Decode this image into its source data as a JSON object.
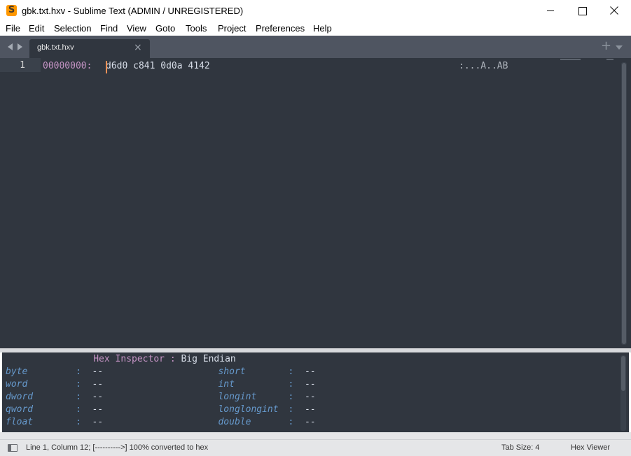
{
  "window": {
    "title": "gbk.txt.hxv - Sublime Text (ADMIN / UNREGISTERED)",
    "app_icon_letter": "S",
    "app_icon_color": "#ff9800"
  },
  "menu": [
    "File",
    "Edit",
    "Selection",
    "Find",
    "View",
    "Goto",
    "Tools",
    "Project",
    "Preferences",
    "Help"
  ],
  "tabs": [
    {
      "label": "gbk.txt.hxv",
      "active": true
    }
  ],
  "editor": {
    "line_number": "1",
    "offset": "00000000:",
    "bytes": "d6d0 c841 0d0a 4142",
    "ascii": ":...A..AB"
  },
  "inspector": {
    "title_kw": "Hex Inspector",
    "title_sep": ":",
    "endian": "Big Endian",
    "rows": [
      {
        "left_label": "byte",
        "left_value": "--",
        "right_label": "short",
        "right_value": "--"
      },
      {
        "left_label": "word",
        "left_value": "--",
        "right_label": "int",
        "right_value": "--"
      },
      {
        "left_label": "dword",
        "left_value": "--",
        "right_label": "longint",
        "right_value": "--"
      },
      {
        "left_label": "qword",
        "left_value": "--",
        "right_label": "longlongint",
        "right_value": "--"
      },
      {
        "left_label": "float",
        "left_value": "--",
        "right_label": "double",
        "right_value": "--"
      }
    ]
  },
  "status": {
    "position": "Line 1, Column 12; [---------->] 100% converted to hex",
    "tab_size": "Tab Size: 4",
    "syntax": "Hex Viewer"
  },
  "colors": {
    "editor_bg": "#30363f",
    "tabbar_bg": "#4f5561",
    "offset_color": "#c594c5",
    "type_color": "#6699cc",
    "caret_color": "#f99157"
  },
  "icons": {
    "nav_back": "triangle-left-icon",
    "nav_forward": "triangle-right-icon",
    "tab_close": "close-icon",
    "new_tab": "plus-icon",
    "tab_list": "chevron-down-icon",
    "panel_toggle": "sidebar-toggle-icon"
  }
}
